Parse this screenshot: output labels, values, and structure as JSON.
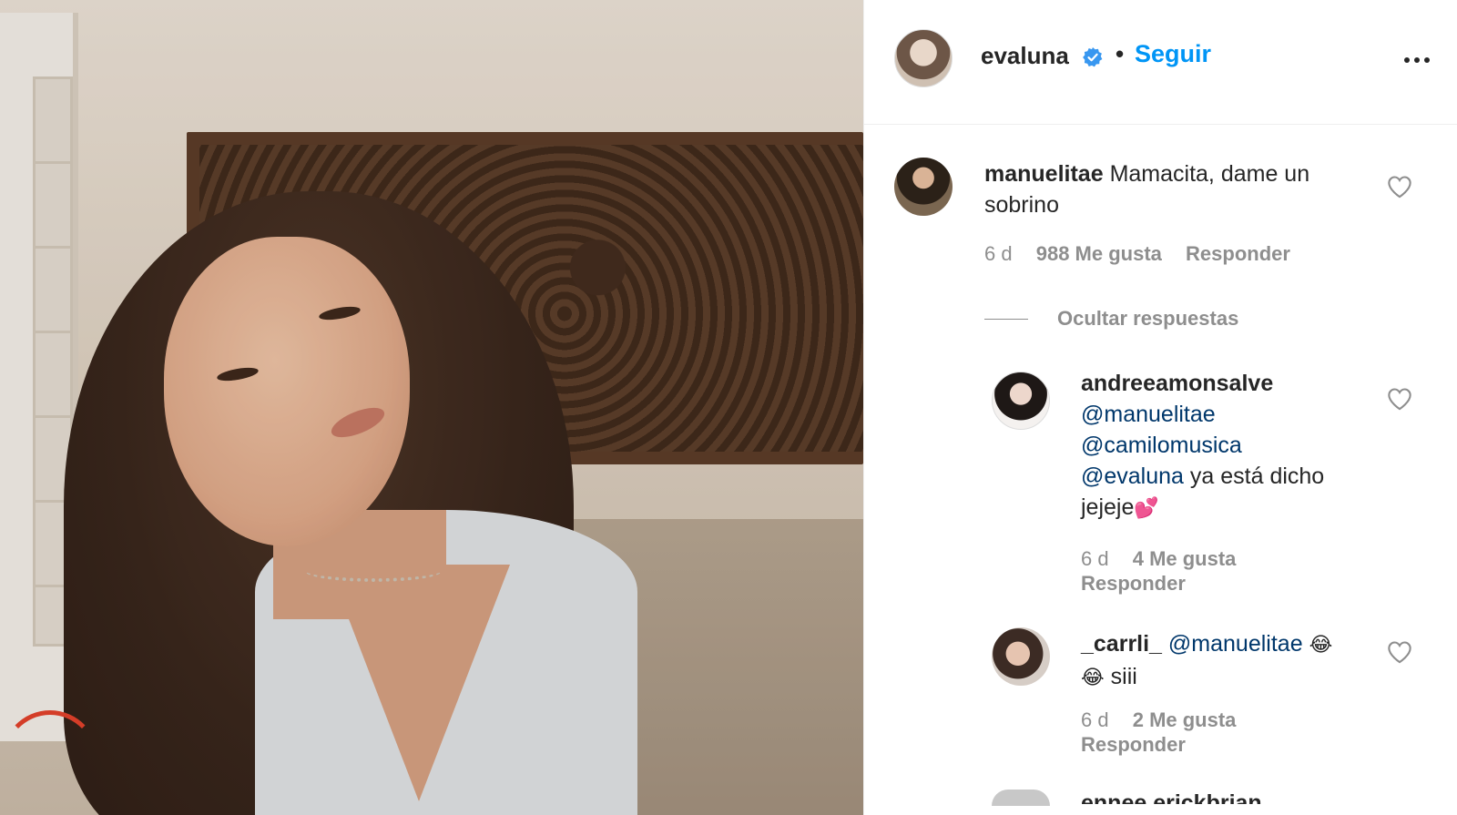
{
  "post": {
    "username": "evaluna",
    "dot": "•",
    "follow_label": "Seguir",
    "verified_icon": "verified-badge-icon",
    "more_icon": "more-options-icon"
  },
  "comments": [
    {
      "username": "manuelitae",
      "text": "Mamacita, dame un sobrino",
      "time": "6 d",
      "likes": "988 Me gusta",
      "reply": "Responder"
    }
  ],
  "hide_replies_label": "Ocultar respuestas",
  "replies": [
    {
      "username": "andreeamonsalve",
      "mention1": "@manuelitae",
      "mention2": "@camilomusica",
      "mention3": "@evaluna",
      "text_after": " ya está dicho",
      "text_last": "jejeje",
      "emoji": "💕",
      "time": "6 d",
      "likes": "4 Me gusta",
      "reply": "Responder"
    },
    {
      "username": "_carrli_",
      "mention1": "@manuelitae",
      "emoji": "😂",
      "text_last": "siii",
      "time": "6 d",
      "likes": "2 Me gusta",
      "reply": "Responder"
    },
    {
      "username": "ennee.erickbrian"
    }
  ],
  "colors": {
    "link_blue": "#0095f6",
    "mention_blue": "#00376b",
    "meta_gray": "#8e8e8e",
    "text_dark": "#262626"
  }
}
